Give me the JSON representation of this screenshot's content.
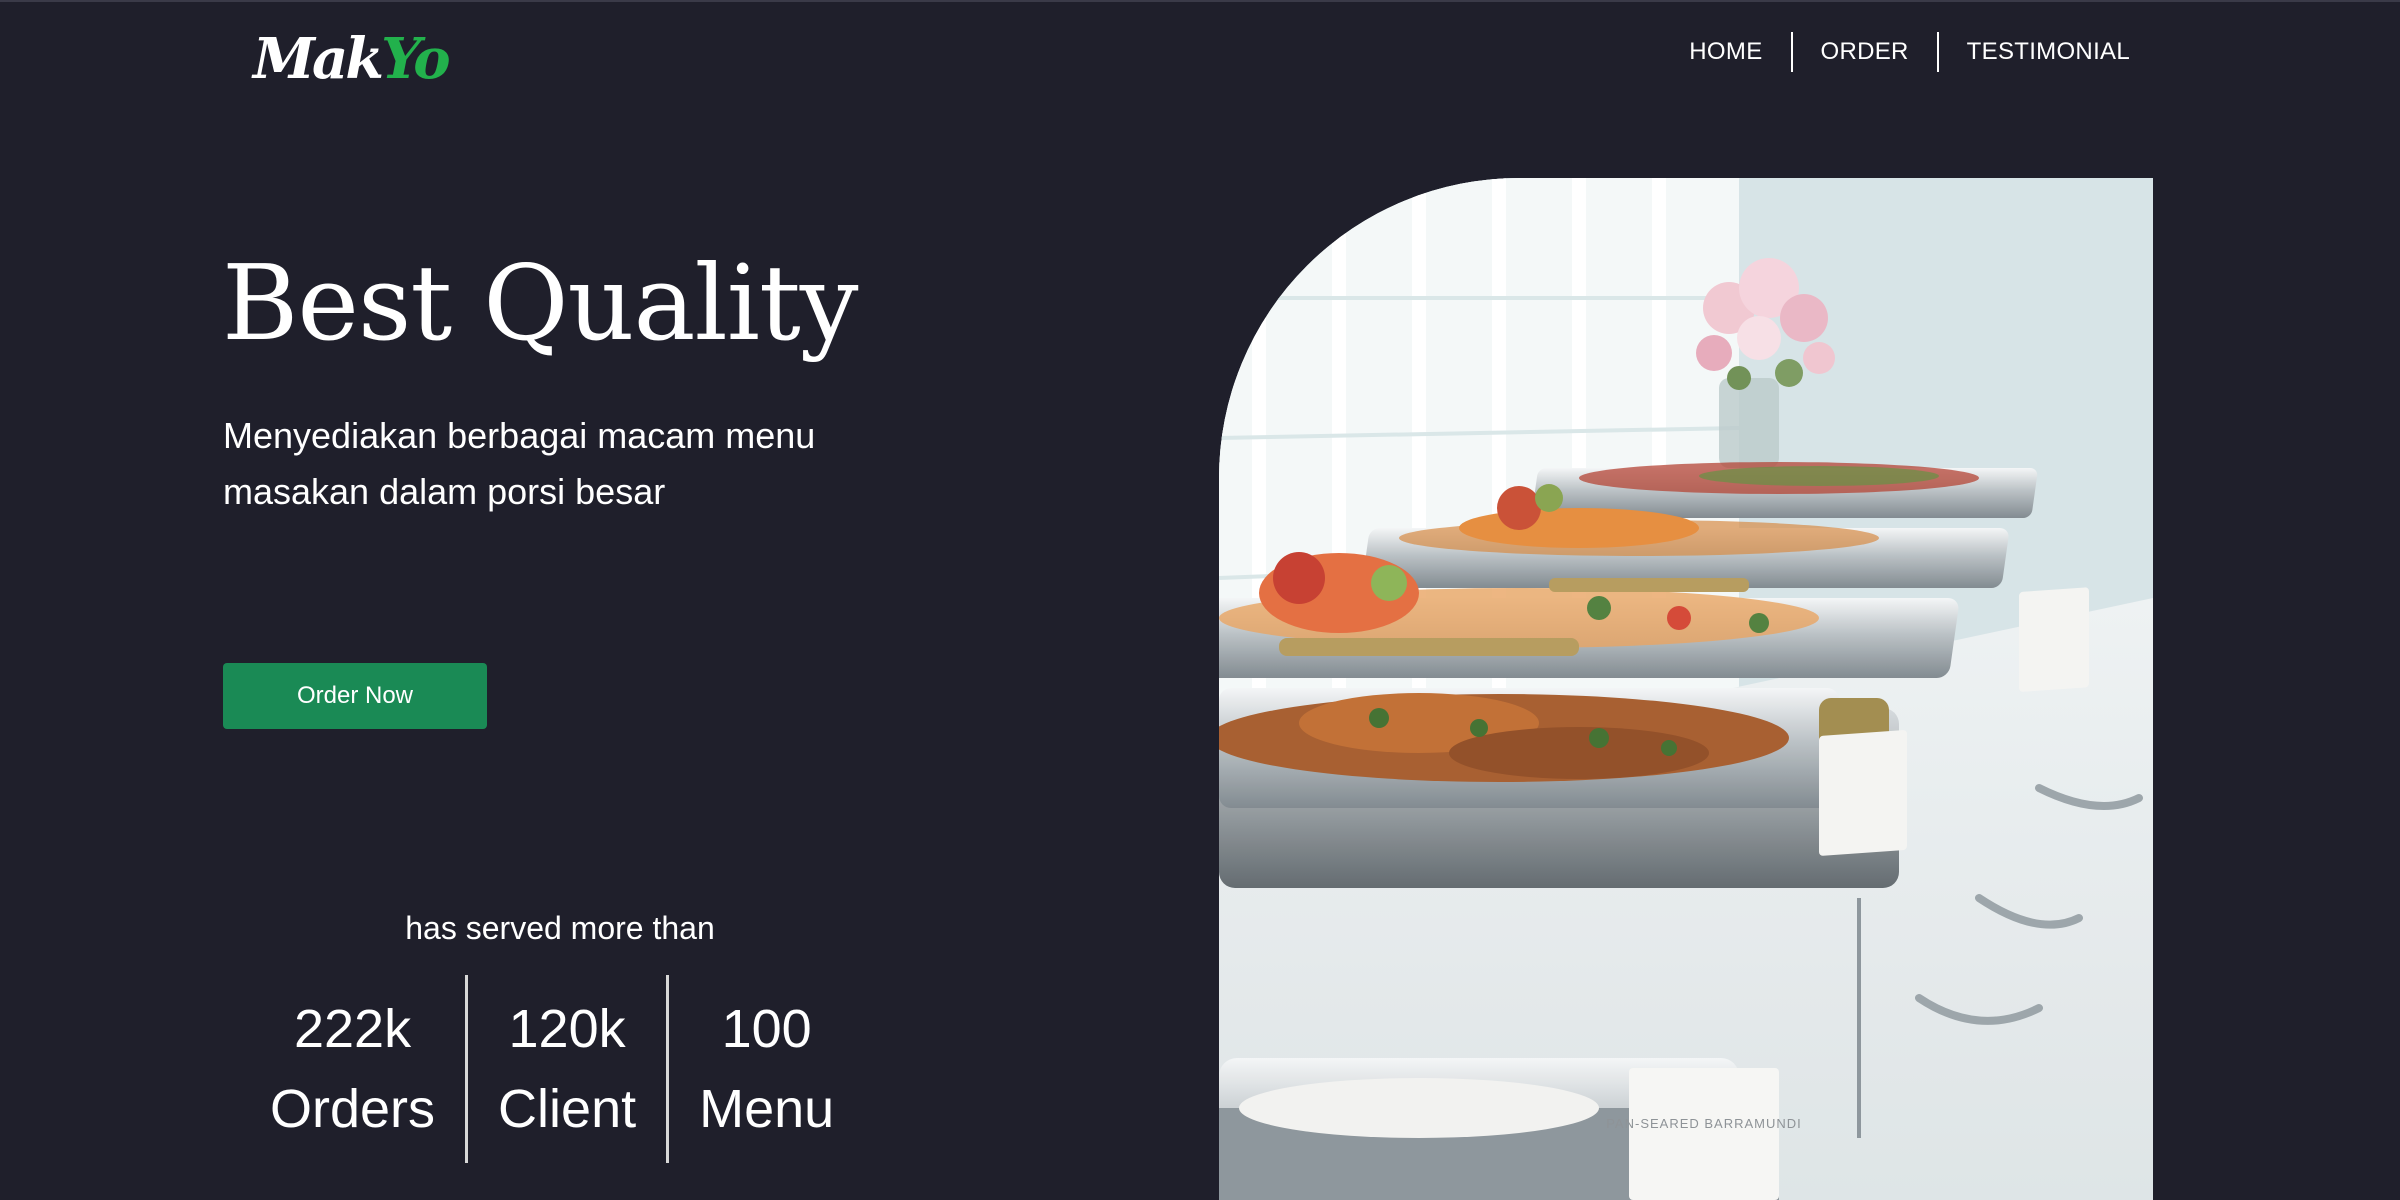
{
  "brand": {
    "logo_part_a": "Mak",
    "logo_part_b": "Yo"
  },
  "nav": {
    "items": [
      {
        "label": "HOME"
      },
      {
        "label": "ORDER"
      },
      {
        "label": "TESTIMONIAL"
      }
    ]
  },
  "hero": {
    "title": "Best Quality",
    "subtitle": "Menyediakan berbagai macam menu masakan dalam porsi besar",
    "cta_label": "Order Now",
    "image_tent_card_label": "PAN-SEARED BARRAMUNDI"
  },
  "stats": {
    "intro": "has served more than",
    "items": [
      {
        "value": "222k",
        "label": "Orders"
      },
      {
        "value": "120k",
        "label": "Client"
      },
      {
        "value": "100",
        "label": "Menu"
      }
    ]
  },
  "colors": {
    "background": "#1f1f2b",
    "accent_green": "#1a8a55",
    "logo_green": "#22b14c",
    "text": "#ffffff"
  }
}
